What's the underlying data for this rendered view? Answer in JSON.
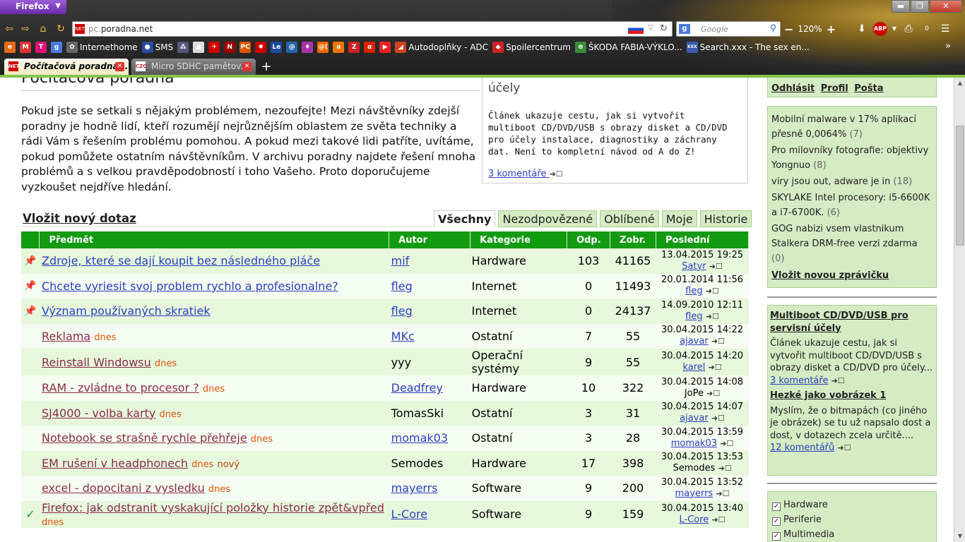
{
  "browser": {
    "menu_label": "Firefox",
    "url_host": "pc.",
    "url_rest": "poradna.net",
    "search_placeholder": "Google",
    "zoom": "120%",
    "bookmarks": [
      {
        "label": "",
        "color": "#e26a1a",
        "icon": "e"
      },
      {
        "label": "",
        "color": "#d33",
        "icon": "M"
      },
      {
        "label": "",
        "color": "#e0107a",
        "icon": "T"
      },
      {
        "label": "",
        "color": "#4a7ae0",
        "icon": "g"
      },
      {
        "label": "Internethome",
        "color": "#666",
        "icon": "✿"
      },
      {
        "label": "SMS",
        "color": "#2a4aa0",
        "icon": "●"
      },
      {
        "label": "",
        "color": "#557",
        "icon": "⁂"
      },
      {
        "label": "",
        "color": "#ddd",
        "icon": "▣"
      },
      {
        "label": "",
        "color": "#c00",
        "icon": "✈"
      },
      {
        "label": "",
        "color": "#900",
        "icon": "N"
      },
      {
        "label": "",
        "color": "#d50",
        "icon": "PC"
      },
      {
        "label": "",
        "color": "#c00",
        "icon": "✹"
      },
      {
        "label": "",
        "color": "#1a4aa0",
        "icon": "Le"
      },
      {
        "label": "",
        "color": "#26a",
        "icon": "@"
      },
      {
        "label": "",
        "color": "#a3a",
        "icon": "♦"
      },
      {
        "label": "",
        "color": "#e60",
        "icon": "@("
      },
      {
        "label": "",
        "color": "#e70",
        "icon": "a"
      },
      {
        "label": "",
        "color": "#c22",
        "icon": "Z"
      },
      {
        "label": "",
        "color": "#d20",
        "icon": "α"
      },
      {
        "label": "",
        "color": "#e22",
        "icon": "▶"
      },
      {
        "label": "Autodoplňky - ADC",
        "color": "#c42",
        "icon": "◢"
      },
      {
        "label": "Spoilercentrum",
        "color": "#c22",
        "icon": "◆"
      },
      {
        "label": "ŠKODA FABIA-VÝKLO...",
        "color": "#3a8a3a",
        "icon": "⊛"
      },
      {
        "label": "Search.xxx - The sex en...",
        "color": "#3a5ab0",
        "icon": "XXX"
      }
    ],
    "tabs": [
      {
        "label": "Počítačová poradna..."
      },
      {
        "label": "Micro SDHC pamětov..."
      }
    ]
  },
  "page": {
    "heading": "Počítačová poradna",
    "intro": "Pokud jste se setkali s nějakým problémem, nezoufejte! Mezi návštěvníky zdejší poradny je hodně lidí, kteří rozumějí nejrůznějším oblastem ze světa techniky a rádi Vám s řešením problému pomohou. A pokud mezi takové lidi patříte, uvítáme, pokud pomůžete ostatním návštěvníkům. V archivu poradny najdete řešení mnoha problémů a s velkou pravděpodobností i toho Vašeho. Proto doporučujeme vyzkoušet nejdříve hledání.",
    "featured": {
      "title": "účely",
      "desc": "Článek ukazuje cestu, jak si vytvořit multiboot CD/DVD/USB s obrazy disket a CD/DVD pro účely instalace, diagnostiky a záchrany dat. Není to kompletní návod od A do Z!",
      "comments": "3 komentáře"
    },
    "new_question": "Vložit nový dotaz",
    "filters": [
      "Všechny",
      "Nezodpovězené",
      "Oblíbené",
      "Moje",
      "Historie"
    ],
    "columns": [
      "Předmět",
      "Autor",
      "Kategorie",
      "Odp.",
      "Zobr.",
      "Poslední"
    ],
    "rows": [
      {
        "pin": "📌",
        "subject": "Zdroje, které se dají koupit bez následného pláče",
        "dnes": "",
        "novy": "",
        "author": "mif",
        "author_link": true,
        "category": "Hardware",
        "odp": "103",
        "zobr": "41165",
        "date": "13.04.2015 19:25",
        "last": "Satyr",
        "last_link": true,
        "read": false
      },
      {
        "pin": "📌",
        "subject": "Chcete vyriesit svoj problem rychlo a profesionalne?",
        "dnes": "",
        "novy": "",
        "author": "fleg",
        "author_link": true,
        "category": "Internet",
        "odp": "0",
        "zobr": "11493",
        "date": "20.01.2014 11:56",
        "last": "fleg",
        "last_link": true,
        "read": false
      },
      {
        "pin": "📌",
        "subject": "Význam používaných skratiek",
        "dnes": "",
        "novy": "",
        "author": "fleg",
        "author_link": true,
        "category": "Internet",
        "odp": "0",
        "zobr": "24137",
        "date": "14.09.2010 12:11",
        "last": "fleg",
        "last_link": true,
        "read": false
      },
      {
        "pin": "",
        "subject": "Reklama",
        "dnes": "dnes",
        "novy": "",
        "author": "MKc",
        "author_link": true,
        "category": "Ostatní",
        "odp": "7",
        "zobr": "55",
        "date": "30.04.2015 14:22",
        "last": "ajavar",
        "last_link": true,
        "read": true
      },
      {
        "pin": "",
        "subject": "Reinstall Windowsu",
        "dnes": "dnes",
        "novy": "",
        "author": "yyy",
        "author_link": false,
        "category": "Operační systémy",
        "odp": "9",
        "zobr": "55",
        "date": "30.04.2015 14:20",
        "last": "karel",
        "last_link": true,
        "read": true
      },
      {
        "pin": "",
        "subject": "RAM - zvládne to procesor ?",
        "dnes": "dnes",
        "novy": "",
        "author": "Deadfrey",
        "author_link": true,
        "category": "Hardware",
        "odp": "10",
        "zobr": "322",
        "date": "30.04.2015 14:08",
        "last": "JoPe",
        "last_link": false,
        "read": true
      },
      {
        "pin": "",
        "subject": "SJ4000 - volba karty",
        "dnes": "dnes",
        "novy": "",
        "author": "TomasSki",
        "author_link": false,
        "category": "Ostatní",
        "odp": "3",
        "zobr": "31",
        "date": "30.04.2015 14:07",
        "last": "ajavar",
        "last_link": true,
        "read": true
      },
      {
        "pin": "",
        "subject": "Notebook se strašně rychle přehřeje",
        "dnes": "dnes",
        "novy": "",
        "author": "momak03",
        "author_link": true,
        "category": "Ostatní",
        "odp": "3",
        "zobr": "28",
        "date": "30.04.2015 13:59",
        "last": "momak03",
        "last_link": true,
        "read": true
      },
      {
        "pin": "",
        "subject": "EM rušení v headphonech",
        "dnes": "dnes",
        "novy": "nový",
        "author": "Semodes",
        "author_link": false,
        "category": "Hardware",
        "odp": "17",
        "zobr": "398",
        "date": "30.04.2015 13:53",
        "last": "Semodes",
        "last_link": false,
        "read": true
      },
      {
        "pin": "",
        "subject": "excel - dopocitani z vysledku",
        "dnes": "dnes",
        "novy": "",
        "author": "mayerrs",
        "author_link": true,
        "category": "Software",
        "odp": "9",
        "zobr": "200",
        "date": "30.04.2015 13:52",
        "last": "mayerrs",
        "last_link": true,
        "read": true
      },
      {
        "pin": "✓",
        "subject": "Firefox: jak odstranit vyskakující položky historie zpět&vpřed",
        "dnes": "dnes",
        "novy": "",
        "author": "L-Core",
        "author_link": true,
        "category": "Software",
        "odp": "9",
        "zobr": "159",
        "date": "30.04.2015 13:40",
        "last": "L-Core",
        "last_link": true,
        "read": true
      }
    ]
  },
  "sidebar": {
    "user_links": [
      "Odhlásit",
      "Profil",
      "Pošta"
    ],
    "news": [
      {
        "text": "Mobilní malware v 17% aplikací přesně 0,0064%",
        "count": "(7)"
      },
      {
        "text": "Pro milovníky fotografie: objektivy Yongnuo",
        "count": "(8)"
      },
      {
        "text": "viry jsou out, adware je in",
        "count": "(18)"
      },
      {
        "text": "SKYLAKE Intel procesory: i5-6600K a i7-6700K.",
        "count": "(6)"
      },
      {
        "text": "GOG nabizi vsem vlastnikum Stalkera DRM-free verzi zdarma",
        "count": "(0)"
      }
    ],
    "add_news": "Vložit novou zprávičku",
    "articles": [
      {
        "title": "Multiboot CD/DVD/USB pro servisní účely",
        "desc": "Článek ukazuje cestu, jak si vytvořit multiboot CD/DVD/USB s obrazy disket a CD/DVD pro účely...",
        "comments": "3 komentáře"
      },
      {
        "title": "Hezké jako vobrázek 1",
        "desc": "Myslím, že o bitmapách (co jiného je obrázek) se tu už napsalo dost a dost, v dotazech zcela určitě....",
        "comments": "12 komentářů"
      }
    ],
    "categories": [
      "Hardware",
      "Periferie",
      "Multimedia"
    ]
  }
}
